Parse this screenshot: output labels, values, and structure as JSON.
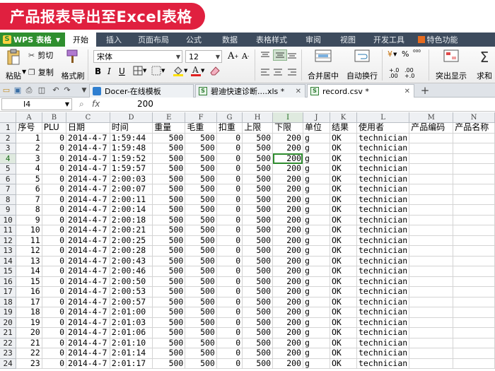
{
  "banner": {
    "title": "产品报表导出至Excel表格"
  },
  "app": {
    "name": "WPS 表格",
    "logo_glyph": "S"
  },
  "menu": [
    "开始",
    "插入",
    "页面布局",
    "公式",
    "数据",
    "表格样式",
    "审阅",
    "视图",
    "开发工具",
    "特色功能"
  ],
  "ribbon": {
    "paste": "粘贴",
    "cut": "剪切",
    "copy": "复制",
    "format_painter": "格式刷",
    "font_name": "宋体",
    "font_size": "12",
    "bold": "B",
    "italic": "I",
    "underline": "U",
    "merge_center": "合并居中",
    "wrap_text": "自动换行",
    "currency": "¥",
    "percent": "%",
    "highlight_display": "突出显示",
    "sum": "求和",
    "grow_font": "A",
    "shrink_font": "A"
  },
  "doc_tabs": [
    {
      "label": "Docer-在线模板",
      "icon": "docer-icon"
    },
    {
      "label": "碧迪快速诊断....xls *",
      "icon": "xls-icon"
    },
    {
      "label": "record.csv *",
      "icon": "xls-icon"
    }
  ],
  "formula_bar": {
    "cell_ref": "I4",
    "fx": "fx",
    "value": "200"
  },
  "grid": {
    "columns": [
      "A",
      "B",
      "C",
      "D",
      "E",
      "F",
      "G",
      "H",
      "I",
      "J",
      "K",
      "L",
      "M",
      "N"
    ],
    "selected_column": "I",
    "selected_row": "4",
    "header_row": [
      "序号",
      "PLU",
      "日期",
      "时间",
      "重量",
      "毛重",
      "扣重",
      "上限",
      "下限",
      "单位",
      "结果",
      "使用者",
      "产品编码",
      "产品名称"
    ],
    "rows": [
      [
        "1",
        "0",
        "2014-4-7",
        "1:59:44",
        "500",
        "500",
        "0",
        "500",
        "200",
        "g",
        "OK",
        "technician"
      ],
      [
        "2",
        "0",
        "2014-4-7",
        "1:59:48",
        "500",
        "500",
        "0",
        "500",
        "200",
        "g",
        "OK",
        "technician"
      ],
      [
        "3",
        "0",
        "2014-4-7",
        "1:59:52",
        "500",
        "500",
        "0",
        "500",
        "200",
        "g",
        "OK",
        "technician"
      ],
      [
        "4",
        "0",
        "2014-4-7",
        "1:59:57",
        "500",
        "500",
        "0",
        "500",
        "200",
        "g",
        "OK",
        "technician"
      ],
      [
        "5",
        "0",
        "2014-4-7",
        "2:00:03",
        "500",
        "500",
        "0",
        "500",
        "200",
        "g",
        "OK",
        "technician"
      ],
      [
        "6",
        "0",
        "2014-4-7",
        "2:00:07",
        "500",
        "500",
        "0",
        "500",
        "200",
        "g",
        "OK",
        "technician"
      ],
      [
        "7",
        "0",
        "2014-4-7",
        "2:00:11",
        "500",
        "500",
        "0",
        "500",
        "200",
        "g",
        "OK",
        "technician"
      ],
      [
        "8",
        "0",
        "2014-4-7",
        "2:00:14",
        "500",
        "500",
        "0",
        "500",
        "200",
        "g",
        "OK",
        "technician"
      ],
      [
        "9",
        "0",
        "2014-4-7",
        "2:00:18",
        "500",
        "500",
        "0",
        "500",
        "200",
        "g",
        "OK",
        "technician"
      ],
      [
        "10",
        "0",
        "2014-4-7",
        "2:00:21",
        "500",
        "500",
        "0",
        "500",
        "200",
        "g",
        "OK",
        "technician"
      ],
      [
        "11",
        "0",
        "2014-4-7",
        "2:00:25",
        "500",
        "500",
        "0",
        "500",
        "200",
        "g",
        "OK",
        "technician"
      ],
      [
        "12",
        "0",
        "2014-4-7",
        "2:00:28",
        "500",
        "500",
        "0",
        "500",
        "200",
        "g",
        "OK",
        "technician"
      ],
      [
        "13",
        "0",
        "2014-4-7",
        "2:00:43",
        "500",
        "500",
        "0",
        "500",
        "200",
        "g",
        "OK",
        "technician"
      ],
      [
        "14",
        "0",
        "2014-4-7",
        "2:00:46",
        "500",
        "500",
        "0",
        "500",
        "200",
        "g",
        "OK",
        "technician"
      ],
      [
        "15",
        "0",
        "2014-4-7",
        "2:00:50",
        "500",
        "500",
        "0",
        "500",
        "200",
        "g",
        "OK",
        "technician"
      ],
      [
        "16",
        "0",
        "2014-4-7",
        "2:00:53",
        "500",
        "500",
        "0",
        "500",
        "200",
        "g",
        "OK",
        "technician"
      ],
      [
        "17",
        "0",
        "2014-4-7",
        "2:00:57",
        "500",
        "500",
        "0",
        "500",
        "200",
        "g",
        "OK",
        "technician"
      ],
      [
        "18",
        "0",
        "2014-4-7",
        "2:01:00",
        "500",
        "500",
        "0",
        "500",
        "200",
        "g",
        "OK",
        "technician"
      ],
      [
        "19",
        "0",
        "2014-4-7",
        "2:01:03",
        "500",
        "500",
        "0",
        "500",
        "200",
        "g",
        "OK",
        "technician"
      ],
      [
        "20",
        "0",
        "2014-4-7",
        "2:01:06",
        "500",
        "500",
        "0",
        "500",
        "200",
        "g",
        "OK",
        "technician"
      ],
      [
        "21",
        "0",
        "2014-4-7",
        "2:01:10",
        "500",
        "500",
        "0",
        "500",
        "200",
        "g",
        "OK",
        "technician"
      ],
      [
        "22",
        "0",
        "2014-4-7",
        "2:01:14",
        "500",
        "500",
        "0",
        "500",
        "200",
        "g",
        "OK",
        "technician"
      ],
      [
        "23",
        "0",
        "2014-4-7",
        "2:01:17",
        "500",
        "500",
        "0",
        "500",
        "200",
        "g",
        "OK",
        "technician"
      ]
    ]
  },
  "colors": {
    "banner": "#e0203f",
    "menubar": "#3d4b5d",
    "app_button": "#2f8f2f",
    "selection": "#2e8b2e"
  }
}
